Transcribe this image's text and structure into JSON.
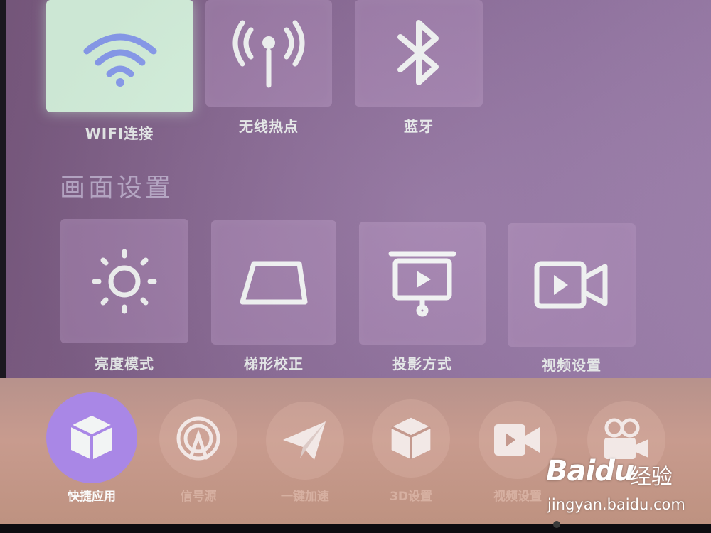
{
  "network": {
    "items": [
      {
        "label": "WIFI连接",
        "icon": "wifi-icon"
      },
      {
        "label": "无线热点",
        "icon": "hotspot-icon"
      },
      {
        "label": "蓝牙",
        "icon": "bluetooth-icon"
      }
    ]
  },
  "picture_settings": {
    "title": "画面设置",
    "items": [
      {
        "label": "亮度模式",
        "icon": "sun-icon"
      },
      {
        "label": "梯形校正",
        "icon": "trapezoid-icon"
      },
      {
        "label": "投影方式",
        "icon": "projector-screen-icon"
      },
      {
        "label": "视频设置",
        "icon": "video-camera-icon"
      }
    ]
  },
  "dock": {
    "items": [
      {
        "label": "快捷应用",
        "icon": "cube-icon",
        "active": true
      },
      {
        "label": "信号源",
        "icon": "signal-source-icon"
      },
      {
        "label": "一键加速",
        "icon": "paper-plane-icon"
      },
      {
        "label": "3D设置",
        "icon": "cube-3d-icon"
      },
      {
        "label": "视频设置",
        "icon": "video-camera-icon"
      },
      {
        "label": "",
        "icon": "movie-camera-icon"
      }
    ]
  },
  "watermark": {
    "brand": "Baidu",
    "suffix": "经验",
    "url": "jingyan.baidu.com"
  },
  "colors": {
    "accent": "#a987e6",
    "focus_tile": "#d7f3df",
    "icon_white": "#f2f4f4"
  }
}
